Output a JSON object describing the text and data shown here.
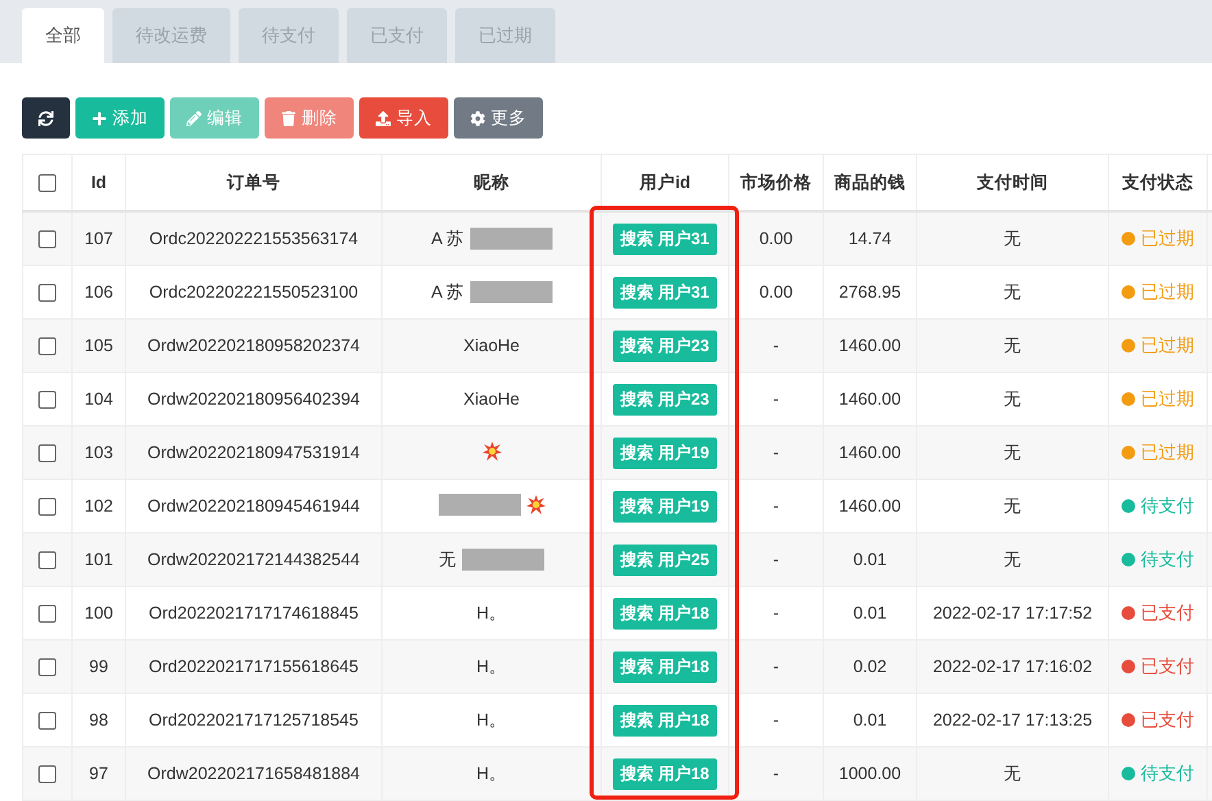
{
  "tabs": [
    {
      "label": "全部",
      "selected": true
    },
    {
      "label": "待改运费",
      "selected": false
    },
    {
      "label": "待支付",
      "selected": false
    },
    {
      "label": "已支付",
      "selected": false
    },
    {
      "label": "已过期",
      "selected": false
    }
  ],
  "toolbar": [
    {
      "kind": "refresh"
    },
    {
      "kind": "add",
      "label": "添加"
    },
    {
      "kind": "edit",
      "label": "编辑"
    },
    {
      "kind": "delete",
      "label": "删除"
    },
    {
      "kind": "import",
      "label": "导入"
    },
    {
      "kind": "more",
      "label": "更多"
    }
  ],
  "table": {
    "all_checked": false,
    "columns": [
      {
        "kind": "check"
      },
      {
        "label": "Id"
      },
      {
        "label": "订单号"
      },
      {
        "label": "昵称"
      },
      {
        "label": "用户id",
        "highlighted": true
      },
      {
        "label": "市场价格"
      },
      {
        "label": "商品的钱"
      },
      {
        "label": "支付时间"
      },
      {
        "label": "支付状态"
      }
    ],
    "rows": [
      {
        "checked": false,
        "id": "107",
        "order": "Ordc202202221553563174",
        "nickname": "A 苏",
        "redacted": true,
        "burst": false,
        "user": "搜索 用户31",
        "market": "0.00",
        "money": "14.74",
        "paid_at": "无",
        "status": "已过期",
        "color": "#f39c12"
      },
      {
        "checked": false,
        "id": "106",
        "order": "Ordc202202221550523100",
        "nickname": "A 苏",
        "redacted": true,
        "burst": false,
        "user": "搜索 用户31",
        "market": "0.00",
        "money": "2768.95",
        "paid_at": "无",
        "status": "已过期",
        "color": "#f39c12"
      },
      {
        "checked": false,
        "id": "105",
        "order": "Ordw202202180958202374",
        "nickname": "XiaoHe",
        "redacted": false,
        "burst": false,
        "user": "搜索 用户23",
        "market": "-",
        "money": "1460.00",
        "paid_at": "无",
        "status": "已过期",
        "color": "#f39c12"
      },
      {
        "checked": false,
        "id": "104",
        "order": "Ordw202202180956402394",
        "nickname": "XiaoHe",
        "redacted": false,
        "burst": false,
        "user": "搜索 用户23",
        "market": "-",
        "money": "1460.00",
        "paid_at": "无",
        "status": "已过期",
        "color": "#f39c12"
      },
      {
        "checked": false,
        "id": "103",
        "order": "Ordw202202180947531914",
        "redacted": false,
        "burst": true,
        "user": "搜索 用户19",
        "market": "-",
        "money": "1460.00",
        "paid_at": "无",
        "status": "已过期",
        "color": "#f39c12"
      },
      {
        "checked": false,
        "id": "102",
        "order": "Ordw202202180945461944",
        "redacted": true,
        "burst": true,
        "user": "搜索 用户19",
        "market": "-",
        "money": "1460.00",
        "paid_at": "无",
        "status": "待支付",
        "color": "#18bc9c"
      },
      {
        "checked": false,
        "id": "101",
        "order": "Ordw202202172144382544",
        "nickname": "无",
        "redacted": true,
        "burst": false,
        "user": "搜索 用户25",
        "market": "-",
        "money": "0.01",
        "paid_at": "无",
        "status": "待支付",
        "color": "#18bc9c"
      },
      {
        "checked": false,
        "id": "100",
        "order": "Ord2022021717174618845",
        "nickname": "H。",
        "redacted": false,
        "burst": false,
        "user": "搜索 用户18",
        "market": "-",
        "money": "0.01",
        "paid_at": "2022-02-17 17:17:52",
        "status": "已支付",
        "color": "#e74c3c"
      },
      {
        "checked": false,
        "id": "99",
        "order": "Ord2022021717155618645",
        "nickname": "H。",
        "redacted": false,
        "burst": false,
        "user": "搜索 用户18",
        "market": "-",
        "money": "0.02",
        "paid_at": "2022-02-17 17:16:02",
        "status": "已支付",
        "color": "#e74c3c"
      },
      {
        "checked": false,
        "id": "98",
        "order": "Ord2022021717125718545",
        "nickname": "H。",
        "redacted": false,
        "burst": false,
        "user": "搜索 用户18",
        "market": "-",
        "money": "0.01",
        "paid_at": "2022-02-17 17:13:25",
        "status": "已支付",
        "color": "#e74c3c"
      },
      {
        "checked": false,
        "id": "97",
        "order": "Ordw202202171658481884",
        "nickname": "H。",
        "redacted": false,
        "burst": false,
        "user": "搜索 用户18",
        "market": "-",
        "money": "1000.00",
        "paid_at": "无",
        "status": "待支付",
        "color": "#18bc9c"
      }
    ]
  }
}
